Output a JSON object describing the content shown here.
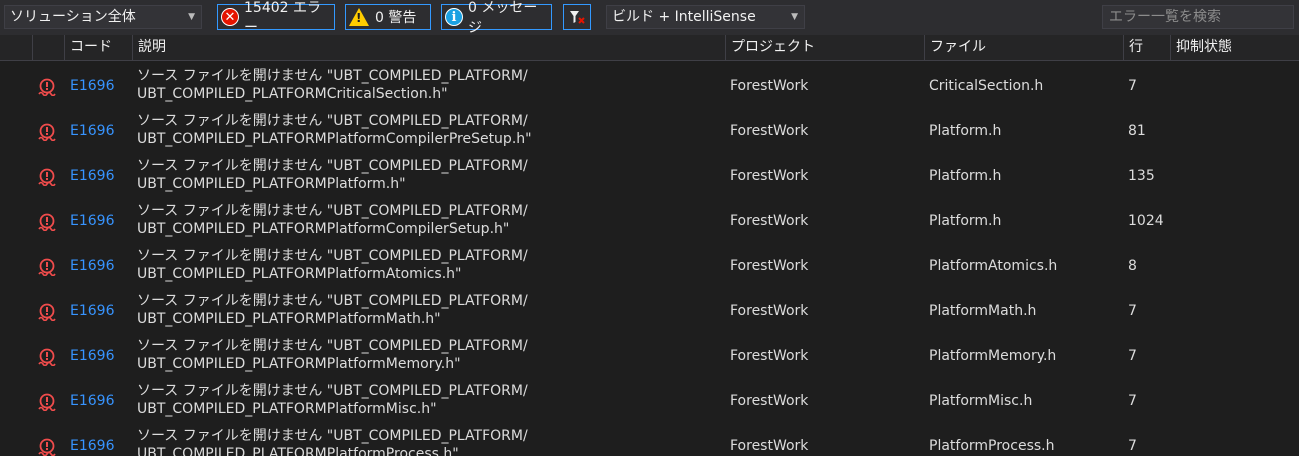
{
  "toolbar": {
    "scope": "ソリューション全体",
    "errors": "15402 エラー",
    "warnings": "0 警告",
    "messages": "0 メッセージ",
    "build_mode": "ビルド + IntelliSense",
    "search_placeholder": "エラー一覧を検索"
  },
  "columns": {
    "code": "コード",
    "description": "説明",
    "project": "プロジェクト",
    "file": "ファイル",
    "line": "行",
    "suppression": "抑制状態"
  },
  "rows": [
    {
      "code": "E1696",
      "desc1": "ソース ファイルを開けません \"UBT_COMPILED_PLATFORM/",
      "desc2": "UBT_COMPILED_PLATFORMCriticalSection.h\"",
      "project": "ForestWork",
      "file": "CriticalSection.h",
      "line": "7"
    },
    {
      "code": "E1696",
      "desc1": "ソース ファイルを開けません \"UBT_COMPILED_PLATFORM/",
      "desc2": "UBT_COMPILED_PLATFORMPlatformCompilerPreSetup.h\"",
      "project": "ForestWork",
      "file": "Platform.h",
      "line": "81"
    },
    {
      "code": "E1696",
      "desc1": "ソース ファイルを開けません \"UBT_COMPILED_PLATFORM/",
      "desc2": "UBT_COMPILED_PLATFORMPlatform.h\"",
      "project": "ForestWork",
      "file": "Platform.h",
      "line": "135"
    },
    {
      "code": "E1696",
      "desc1": "ソース ファイルを開けません \"UBT_COMPILED_PLATFORM/",
      "desc2": "UBT_COMPILED_PLATFORMPlatformCompilerSetup.h\"",
      "project": "ForestWork",
      "file": "Platform.h",
      "line": "1024"
    },
    {
      "code": "E1696",
      "desc1": "ソース ファイルを開けません \"UBT_COMPILED_PLATFORM/",
      "desc2": "UBT_COMPILED_PLATFORMPlatformAtomics.h\"",
      "project": "ForestWork",
      "file": "PlatformAtomics.h",
      "line": "8"
    },
    {
      "code": "E1696",
      "desc1": "ソース ファイルを開けません \"UBT_COMPILED_PLATFORM/",
      "desc2": "UBT_COMPILED_PLATFORMPlatformMath.h\"",
      "project": "ForestWork",
      "file": "PlatformMath.h",
      "line": "7"
    },
    {
      "code": "E1696",
      "desc1": "ソース ファイルを開けません \"UBT_COMPILED_PLATFORM/",
      "desc2": "UBT_COMPILED_PLATFORMPlatformMemory.h\"",
      "project": "ForestWork",
      "file": "PlatformMemory.h",
      "line": "7"
    },
    {
      "code": "E1696",
      "desc1": "ソース ファイルを開けません \"UBT_COMPILED_PLATFORM/",
      "desc2": "UBT_COMPILED_PLATFORMPlatformMisc.h\"",
      "project": "ForestWork",
      "file": "PlatformMisc.h",
      "line": "7"
    },
    {
      "code": "E1696",
      "desc1": "ソース ファイルを開けません \"UBT_COMPILED_PLATFORM/",
      "desc2": "UBT_COMPILED_PLATFORMPlatformProcess.h\"",
      "project": "ForestWork",
      "file": "PlatformProcess.h",
      "line": "7"
    }
  ]
}
